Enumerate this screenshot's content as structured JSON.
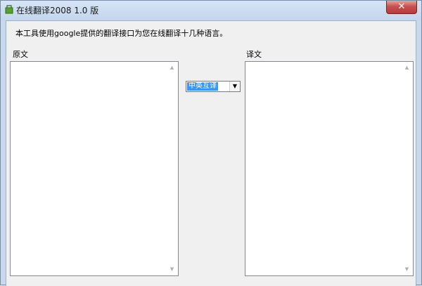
{
  "window": {
    "title": "在线翻译2008 1.0 版",
    "close_glyph": "✕",
    "icon": "app-icon"
  },
  "main": {
    "description": "本工具使用google提供的翻译接口为您在线翻译十几种语言。",
    "source_label": "原文",
    "target_label": "译文",
    "source_text": "",
    "target_text": ""
  },
  "language_select": {
    "selected": "中英互译",
    "arrow_glyph": "▼"
  },
  "scrollbar": {
    "up_glyph": "▲",
    "down_glyph": "▼"
  }
}
